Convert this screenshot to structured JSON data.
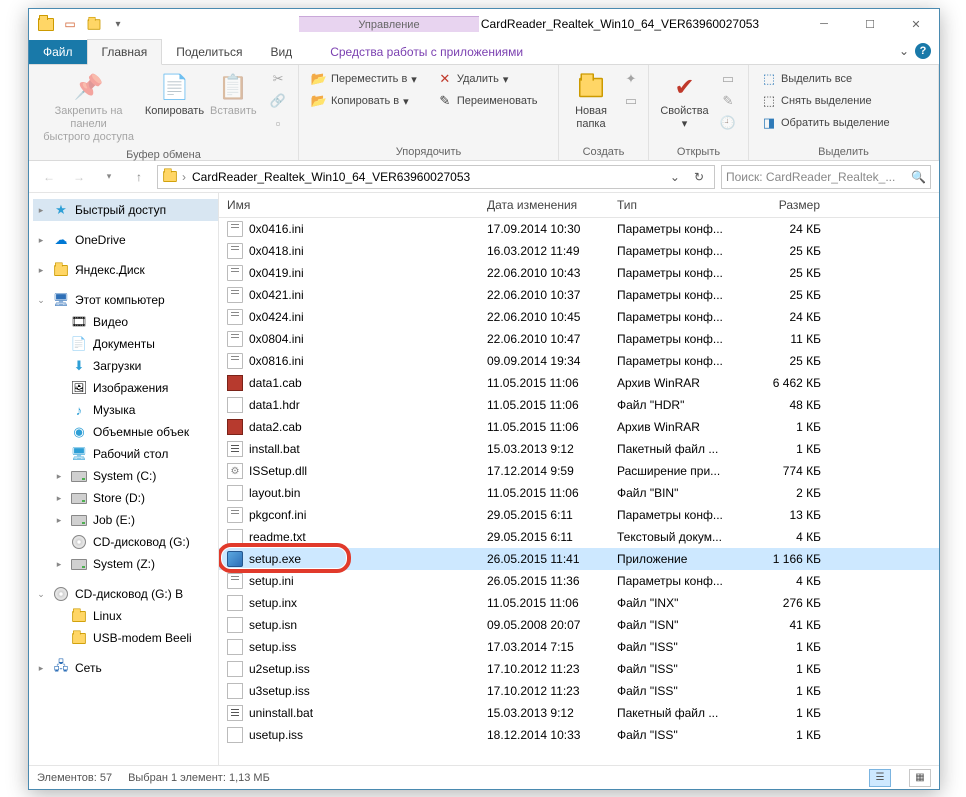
{
  "title": "CardReader_Realtek_Win10_64_VER63960027053",
  "context_tab": {
    "top": "Управление",
    "bottom": "Средства работы с приложениями"
  },
  "tabs": {
    "file": "Файл",
    "home": "Главная",
    "share": "Поделиться",
    "view": "Вид"
  },
  "ribbon": {
    "clipboard": {
      "label": "Буфер обмена",
      "pin": "Закрепить на панели\nбыстрого доступа",
      "copy": "Копировать",
      "paste": "Вставить"
    },
    "organize": {
      "label": "Упорядочить",
      "moveto": "Переместить в",
      "copyto": "Копировать в",
      "delete": "Удалить",
      "rename": "Переименовать"
    },
    "new": {
      "label": "Создать",
      "newfolder": "Новая\nпапка"
    },
    "open": {
      "label": "Открыть",
      "properties": "Свойства"
    },
    "select": {
      "label": "Выделить",
      "selectall": "Выделить все",
      "selectnone": "Снять выделение",
      "invert": "Обратить выделение"
    }
  },
  "breadcrumb": {
    "folder": "CardReader_Realtek_Win10_64_VER63960027053"
  },
  "search_placeholder": "Поиск: CardReader_Realtek_...",
  "nav": {
    "quick": "Быстрый доступ",
    "onedrive": "OneDrive",
    "yandex": "Яндекс.Диск",
    "thispc": "Этот компьютер",
    "videos": "Видео",
    "documents": "Документы",
    "downloads": "Загрузки",
    "pictures": "Изображения",
    "music": "Музыка",
    "objects3d": "Объемные объек",
    "desktop": "Рабочий стол",
    "systemc": "System (C:)",
    "stored": "Store (D:)",
    "jobe": "Job (E:)",
    "cdg": "CD-дисковод (G:)",
    "systemz": "System (Z:)",
    "cdgb": "CD-дисковод (G:) B",
    "linux": "Linux",
    "usbmodem": "USB-modem Beeli",
    "network": "Сеть"
  },
  "columns": {
    "name": "Имя",
    "date": "Дата изменения",
    "type": "Тип",
    "size": "Размер"
  },
  "files": [
    {
      "icon": "ini",
      "name": "0x0416.ini",
      "date": "17.09.2014 10:30",
      "type": "Параметры конф...",
      "size": "24 КБ"
    },
    {
      "icon": "ini",
      "name": "0x0418.ini",
      "date": "16.03.2012 11:49",
      "type": "Параметры конф...",
      "size": "25 КБ"
    },
    {
      "icon": "ini",
      "name": "0x0419.ini",
      "date": "22.06.2010 10:43",
      "type": "Параметры конф...",
      "size": "25 КБ"
    },
    {
      "icon": "ini",
      "name": "0x0421.ini",
      "date": "22.06.2010 10:37",
      "type": "Параметры конф...",
      "size": "25 КБ"
    },
    {
      "icon": "ini",
      "name": "0x0424.ini",
      "date": "22.06.2010 10:45",
      "type": "Параметры конф...",
      "size": "24 КБ"
    },
    {
      "icon": "ini",
      "name": "0x0804.ini",
      "date": "22.06.2010 10:47",
      "type": "Параметры конф...",
      "size": "11 КБ"
    },
    {
      "icon": "ini",
      "name": "0x0816.ini",
      "date": "09.09.2014 19:34",
      "type": "Параметры конф...",
      "size": "25 КБ"
    },
    {
      "icon": "cab",
      "name": "data1.cab",
      "date": "11.05.2015 11:06",
      "type": "Архив WinRAR",
      "size": "6 462 КБ"
    },
    {
      "icon": "bin",
      "name": "data1.hdr",
      "date": "11.05.2015 11:06",
      "type": "Файл \"HDR\"",
      "size": "48 КБ"
    },
    {
      "icon": "cab",
      "name": "data2.cab",
      "date": "11.05.2015 11:06",
      "type": "Архив WinRAR",
      "size": "1 КБ"
    },
    {
      "icon": "bat",
      "name": "install.bat",
      "date": "15.03.2013 9:12",
      "type": "Пакетный файл ...",
      "size": "1 КБ"
    },
    {
      "icon": "dll",
      "name": "ISSetup.dll",
      "date": "17.12.2014 9:59",
      "type": "Расширение при...",
      "size": "774 КБ"
    },
    {
      "icon": "bin",
      "name": "layout.bin",
      "date": "11.05.2015 11:06",
      "type": "Файл \"BIN\"",
      "size": "2 КБ"
    },
    {
      "icon": "ini",
      "name": "pkgconf.ini",
      "date": "29.05.2015 6:11",
      "type": "Параметры конф...",
      "size": "13 КБ"
    },
    {
      "icon": "txt",
      "name": "readme.txt",
      "date": "29.05.2015 6:11",
      "type": "Текстовый докум...",
      "size": "4 КБ"
    },
    {
      "icon": "exe",
      "name": "setup.exe",
      "date": "26.05.2015 11:41",
      "type": "Приложение",
      "size": "1 166 КБ",
      "selected": true,
      "ring": true
    },
    {
      "icon": "ini",
      "name": "setup.ini",
      "date": "26.05.2015 11:36",
      "type": "Параметры конф...",
      "size": "4 КБ"
    },
    {
      "icon": "bin",
      "name": "setup.inx",
      "date": "11.05.2015 11:06",
      "type": "Файл \"INX\"",
      "size": "276 КБ"
    },
    {
      "icon": "bin",
      "name": "setup.isn",
      "date": "09.05.2008 20:07",
      "type": "Файл \"ISN\"",
      "size": "41 КБ"
    },
    {
      "icon": "bin",
      "name": "setup.iss",
      "date": "17.03.2014 7:15",
      "type": "Файл \"ISS\"",
      "size": "1 КБ"
    },
    {
      "icon": "bin",
      "name": "u2setup.iss",
      "date": "17.10.2012 11:23",
      "type": "Файл \"ISS\"",
      "size": "1 КБ"
    },
    {
      "icon": "bin",
      "name": "u3setup.iss",
      "date": "17.10.2012 11:23",
      "type": "Файл \"ISS\"",
      "size": "1 КБ"
    },
    {
      "icon": "bat",
      "name": "uninstall.bat",
      "date": "15.03.2013 9:12",
      "type": "Пакетный файл ...",
      "size": "1 КБ"
    },
    {
      "icon": "bin",
      "name": "usetup.iss",
      "date": "18.12.2014 10:33",
      "type": "Файл \"ISS\"",
      "size": "1 КБ"
    }
  ],
  "status": {
    "items": "Элементов: 57",
    "selection": "Выбран 1 элемент: 1,13 МБ"
  }
}
